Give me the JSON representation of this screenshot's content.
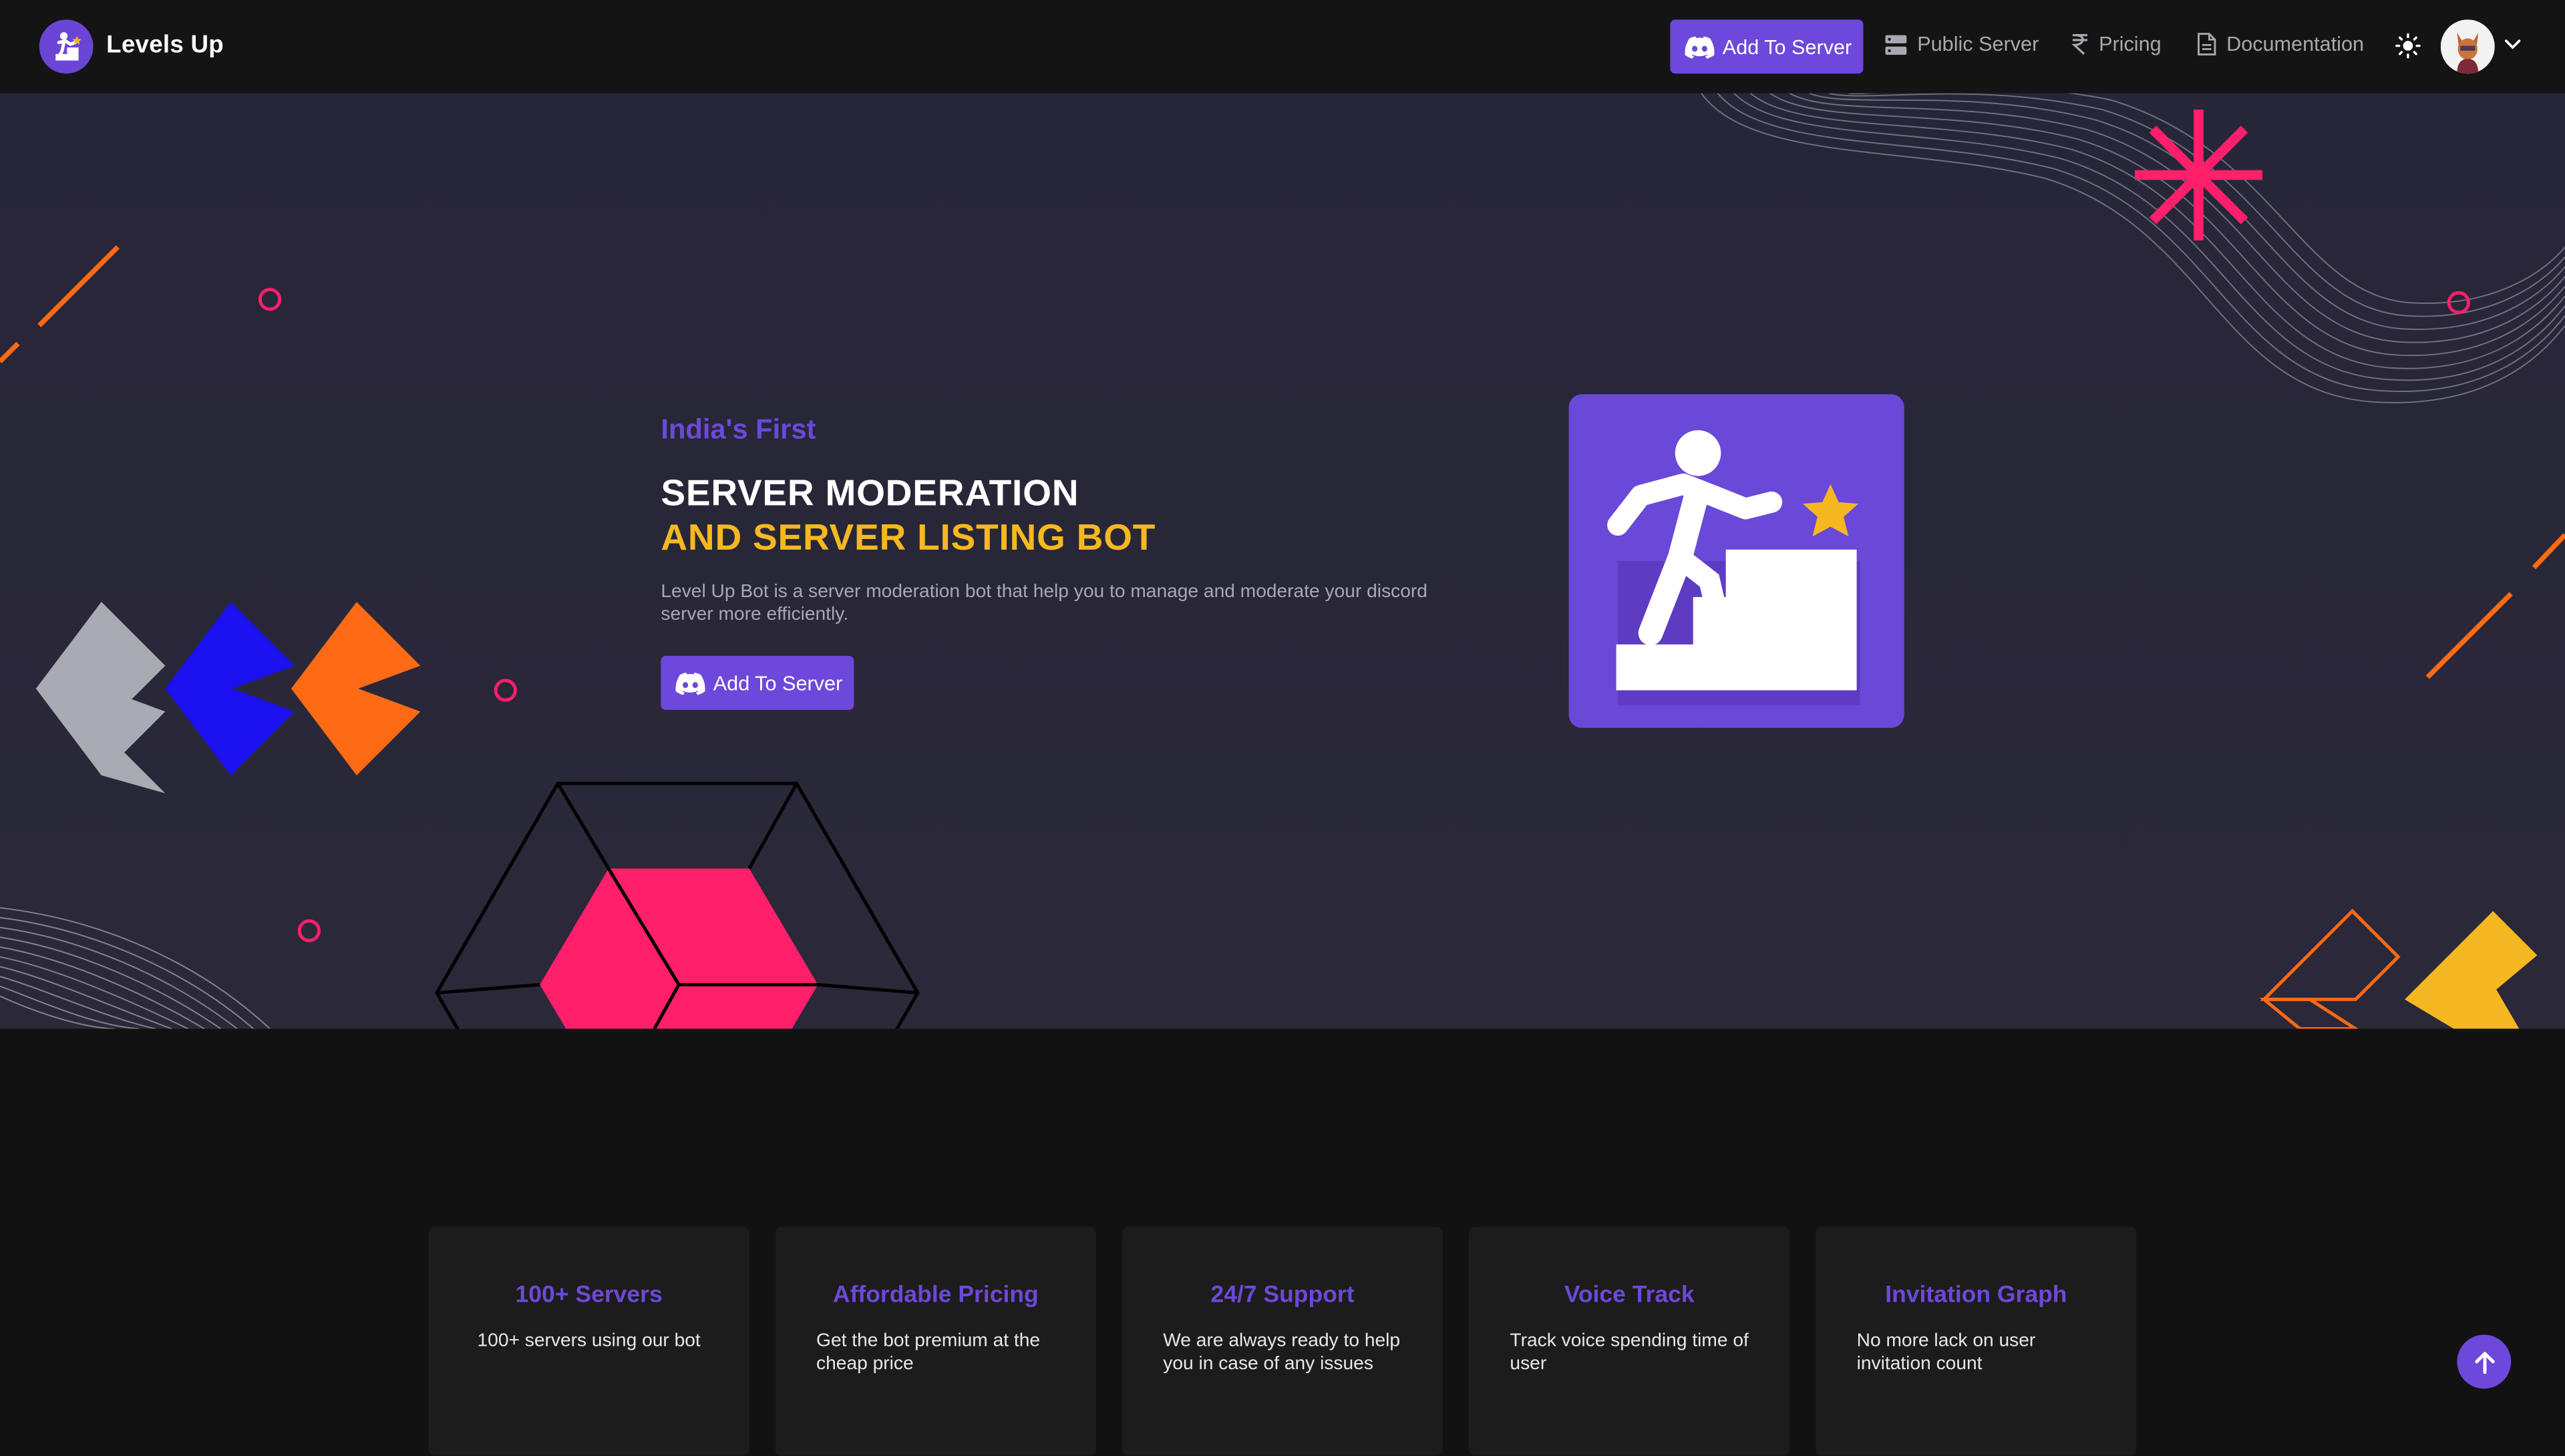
{
  "header": {
    "brand": "Levels Up",
    "add_button": "Add To Server",
    "nav": [
      {
        "label": "Public Server",
        "icon": "server-icon"
      },
      {
        "label": "Pricing",
        "icon": "rupee-icon"
      },
      {
        "label": "Documentation",
        "icon": "document-icon"
      }
    ]
  },
  "hero": {
    "tagline": "India's First",
    "title_line1": "SERVER MODERATION",
    "title_line2": "AND SERVER LISTING BOT",
    "description": "Level Up Bot is a server moderation bot that help you to manage and moderate your discord server more efficiently.",
    "cta": "Add To Server"
  },
  "features": [
    {
      "title": "100+ Servers",
      "text": "100+ servers using our bot"
    },
    {
      "title": "Affordable Pricing",
      "text": "Get the bot premium at the cheap price"
    },
    {
      "title": "24/7 Support",
      "text": "We are always ready to help you in case of any issues"
    },
    {
      "title": "Voice Track",
      "text": "Track voice spending time of user"
    },
    {
      "title": "Invitation Graph",
      "text": "No more lack on user invitation count"
    }
  ],
  "colors": {
    "accent": "#6d48db",
    "highlight": "#f5b820",
    "pink": "#ff1f6b",
    "orange": "#ff6a14",
    "blue": "#1a10f0"
  }
}
